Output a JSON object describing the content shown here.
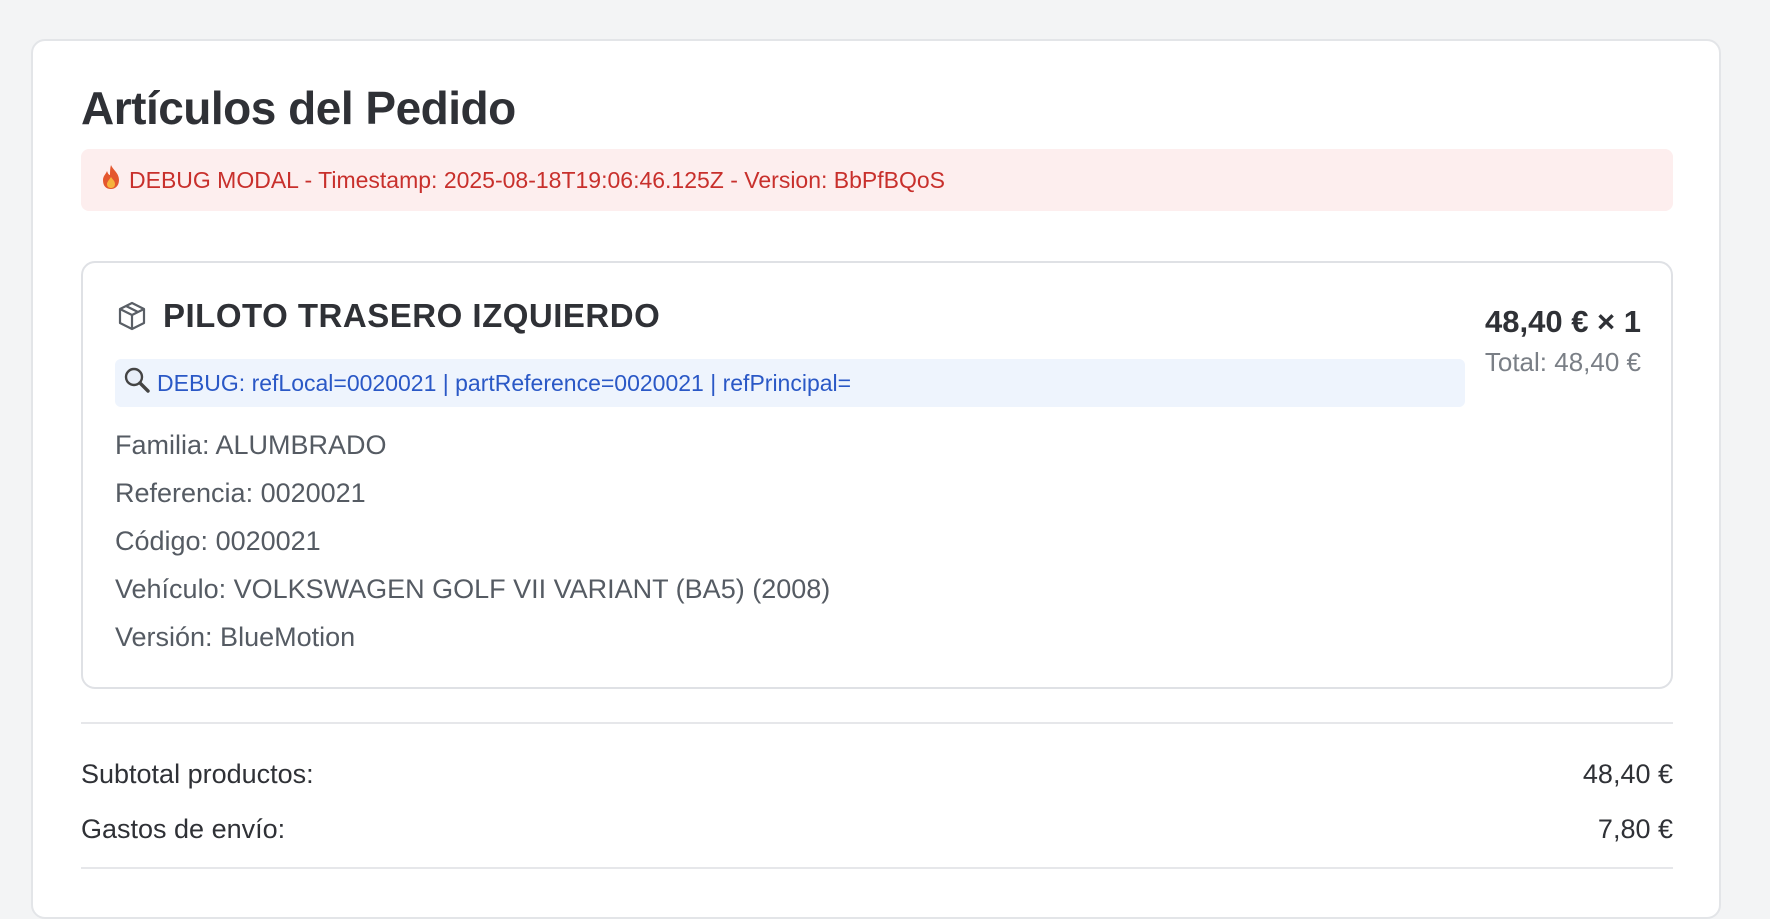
{
  "title": "Artículos del Pedido",
  "debug_banner": {
    "icon": "fire-icon",
    "text": "DEBUG MODAL - Timestamp: 2025-08-18T19:06:46.125Z - Version: BbPfBQoS"
  },
  "item": {
    "icon": "package-box-icon",
    "name": "PILOTO TRASERO IZQUIERDO",
    "debug": {
      "icon": "magnifier-icon",
      "text": "DEBUG: refLocal=0020021 | partReference=0020021 | refPrincipal="
    },
    "details": [
      "Familia: ALUMBRADO",
      "Referencia: 0020021",
      "Código: 0020021",
      "Vehículo: VOLKSWAGEN GOLF VII VARIANT (BA5) (2008)",
      "Versión: BlueMotion"
    ],
    "price_line": "48,40 € × 1",
    "total_line": "Total: 48,40 €"
  },
  "summary": {
    "subtotal_label": "Subtotal productos:",
    "subtotal_value": "48,40 €",
    "shipping_label": "Gastos de envío:",
    "shipping_value": "7,80 €"
  },
  "colors": {
    "debug_banner_bg": "#fdeeee",
    "debug_banner_text": "#c8302c",
    "debug_line_bg": "#eef4fd",
    "debug_line_text": "#2a58c6"
  }
}
